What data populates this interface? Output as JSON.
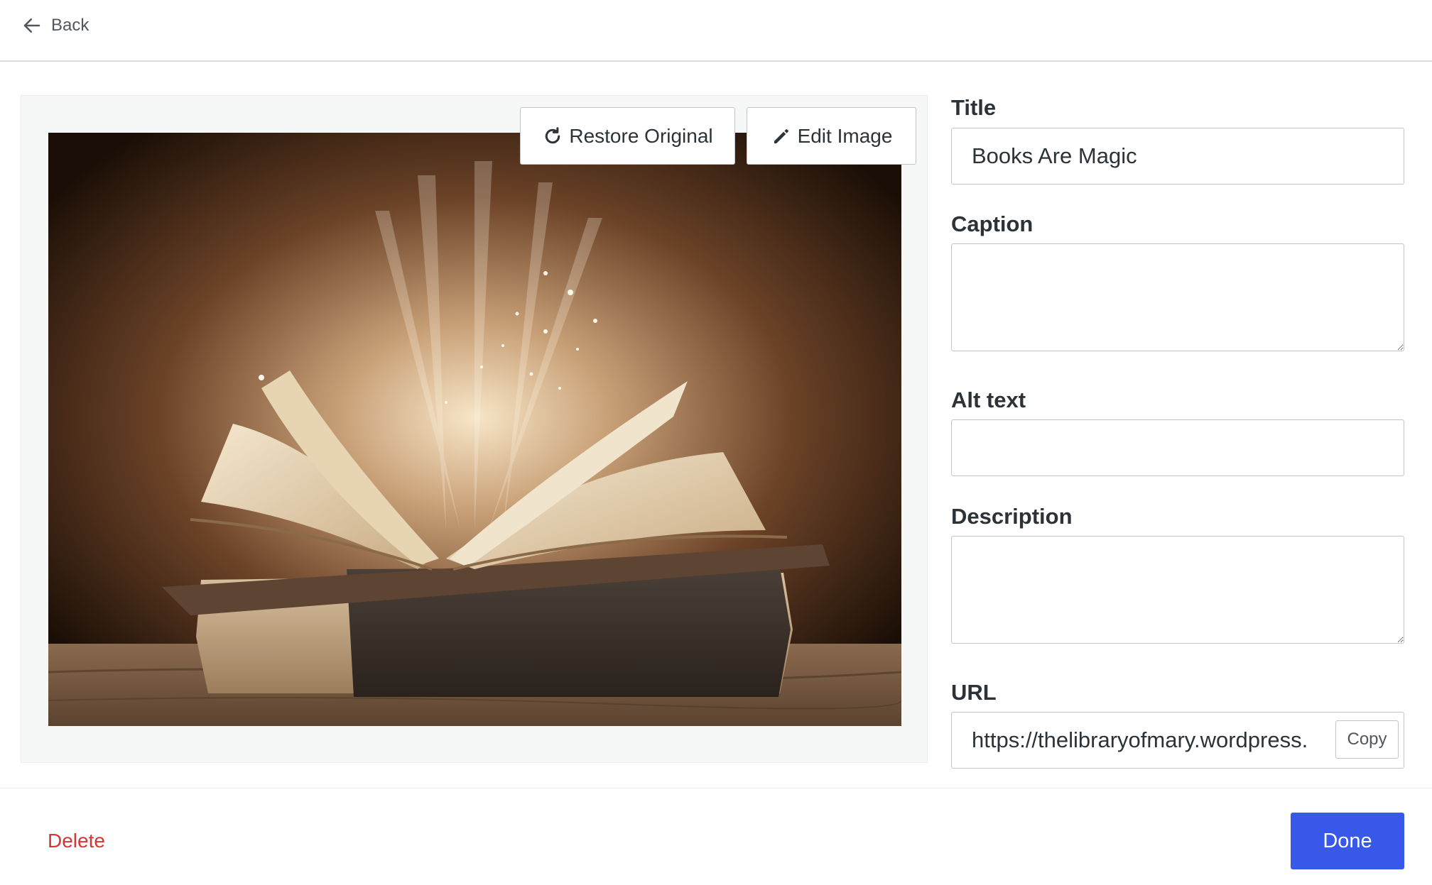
{
  "header": {
    "back_label": "Back",
    "back_icon": "arrow-left-icon"
  },
  "image_panel": {
    "restore_label": "Restore Original",
    "restore_icon": "rotate-right-icon",
    "edit_label": "Edit Image",
    "edit_icon": "pencil-icon",
    "image_description_icon": "open-book-photo"
  },
  "form": {
    "title_label": "Title",
    "title_value": "Books Are Magic",
    "caption_label": "Caption",
    "caption_value": "",
    "alt_label": "Alt text",
    "alt_value": "",
    "description_label": "Description",
    "description_value": "",
    "url_label": "URL",
    "url_value": "https://thelibraryofmary.wordpress.",
    "copy_label": "Copy"
  },
  "footer": {
    "delete_label": "Delete",
    "done_label": "Done"
  },
  "colors": {
    "primary": "#3858e9",
    "danger": "#d63638",
    "text": "#2c3338",
    "border": "#c3c4c7"
  }
}
